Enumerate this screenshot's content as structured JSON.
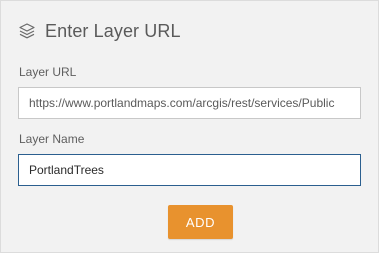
{
  "header": {
    "title": "Enter Layer URL",
    "icon": "layers-icon"
  },
  "layer_url": {
    "label": "Layer URL",
    "value": "https://www.portlandmaps.com/arcgis/rest/services/Public"
  },
  "layer_name": {
    "label": "Layer Name",
    "value": "PortlandTrees"
  },
  "add_button": {
    "label": "ADD"
  },
  "colors": {
    "accent": "#e8922e",
    "panel_bg": "#f2f2f2",
    "focused_border": "#2b5f8f"
  }
}
